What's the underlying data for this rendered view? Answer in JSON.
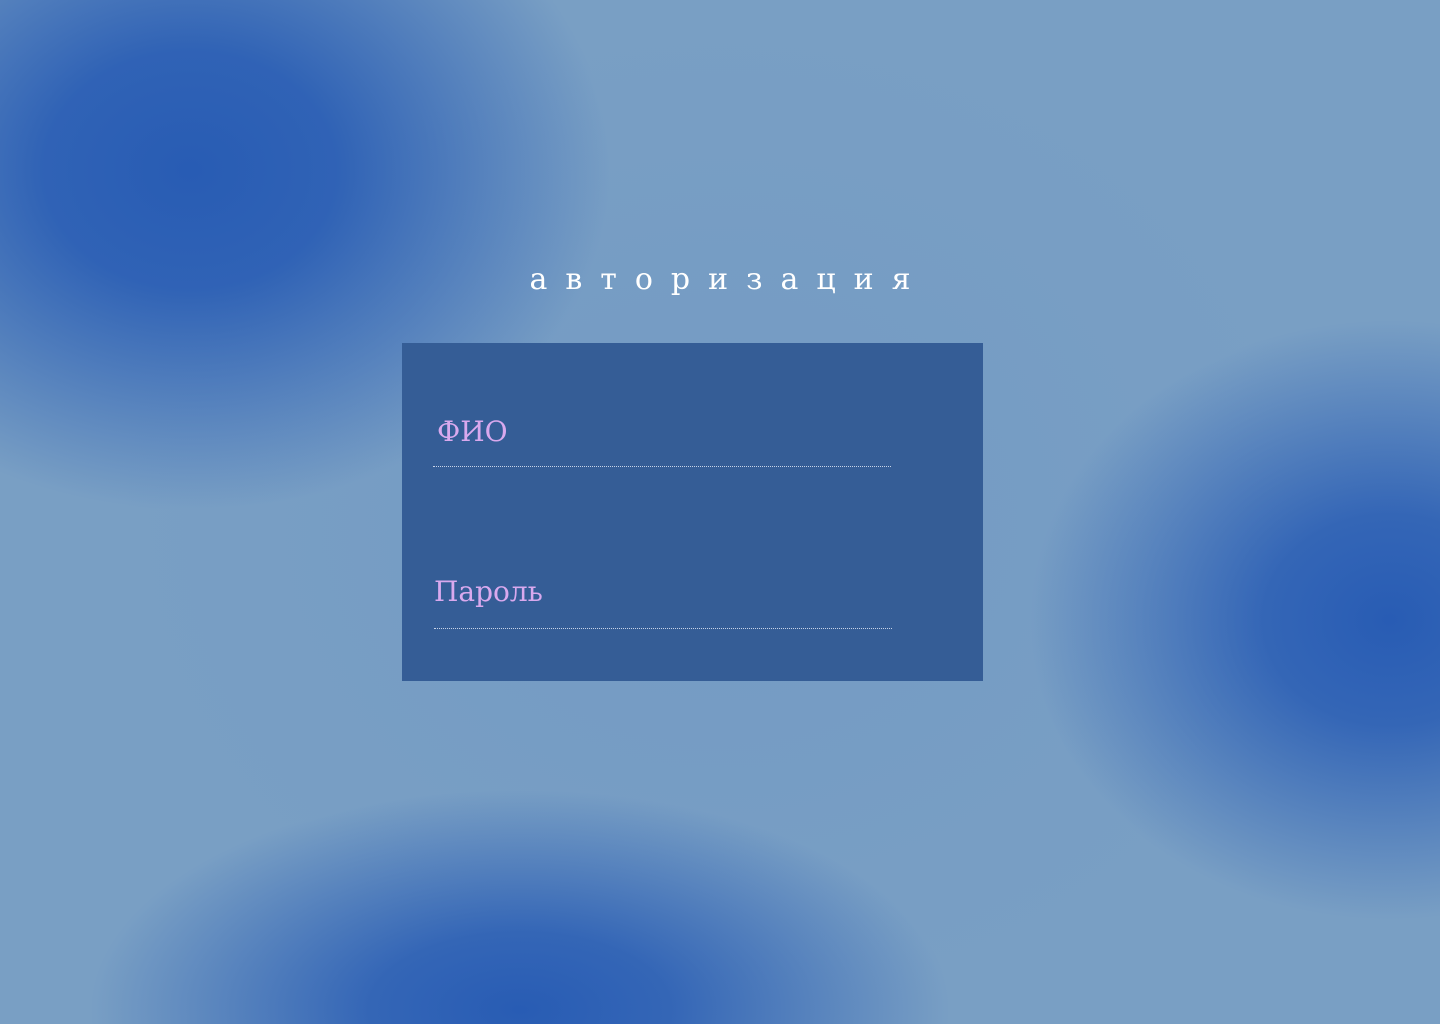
{
  "page": {
    "title": "авторизация"
  },
  "form": {
    "fio": {
      "label": "ФИО",
      "value": ""
    },
    "password": {
      "label": "Пароль",
      "value": ""
    }
  },
  "colors": {
    "background_light": "#799fc4",
    "background_accent": "#2a5eb3",
    "card": "#355d96",
    "label": "#d9a9ee",
    "title": "#ffffff"
  }
}
